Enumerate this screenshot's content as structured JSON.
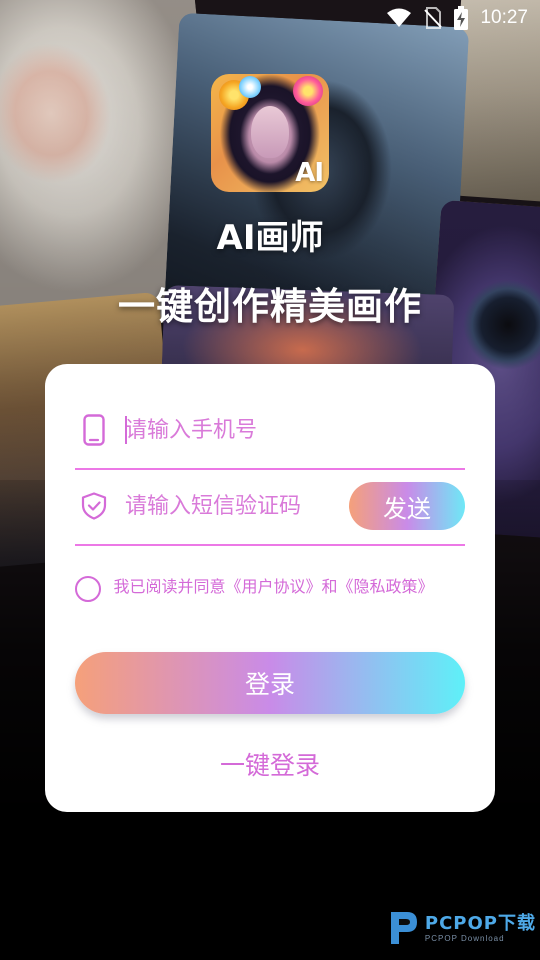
{
  "status_bar": {
    "time": "10:27",
    "icons": [
      "wifi-icon",
      "no-sim-icon",
      "battery-charging-icon"
    ]
  },
  "app": {
    "icon_badge": "AI",
    "title": "AI画师",
    "slogan": "一键创作精美画作"
  },
  "login_form": {
    "phone_placeholder": "请输入手机号",
    "code_placeholder": "请输入短信验证码",
    "send_label": "发送",
    "agreement_text": "我已阅读并同意《用户协议》和《隐私政策》",
    "agreement_checked": false,
    "login_label": "登录",
    "one_click_label": "一键登录"
  },
  "watermark": {
    "main": "PCPOP下载",
    "sub": "PCPOP Download"
  },
  "colors": {
    "accent": "#d46ad8",
    "underline": "#ec78e6",
    "gradient_start": "#f5a07a",
    "gradient_mid": "#c98be8",
    "gradient_end": "#5ef0f8"
  }
}
